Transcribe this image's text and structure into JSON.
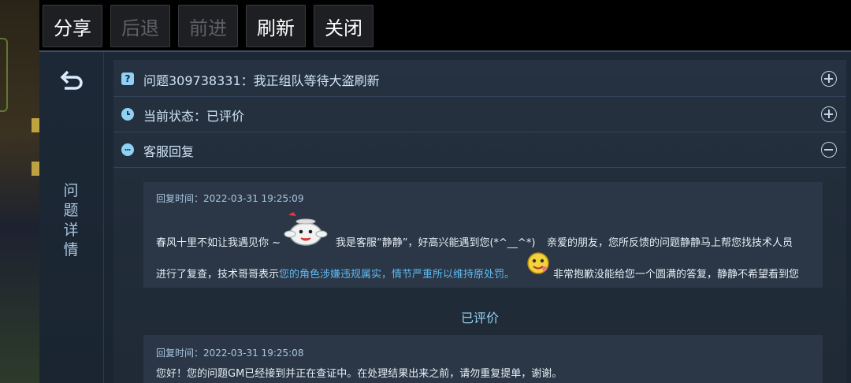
{
  "toolbar": {
    "share": "分享",
    "back": "后退",
    "forward": "前进",
    "refresh": "刷新",
    "close": "关闭"
  },
  "sidebar": {
    "title_chars": [
      "问",
      "题",
      "详",
      "情"
    ]
  },
  "sections": {
    "question": {
      "icon": "question-icon",
      "label": "问题309738331：我正组队等待大盗刷新"
    },
    "status": {
      "icon": "clock-icon",
      "label": "当前状态：已评价"
    },
    "reply": {
      "icon": "chat-icon",
      "label": "客服回复"
    }
  },
  "replies": [
    {
      "time": "回复时间：2022-03-31 19:25:09",
      "part1": "春风十里不如让我遇见你 ~",
      "part2": "我是客服“静静”，好高兴能遇到您(*^__^*)",
      "part3": "亲爱的朋友，您所反馈的问题静静马上帮您找技术人员",
      "line2_a": "进行了复查，技术哥哥表示",
      "line2_highlight": "您的角色涉嫌违规属实，情节严重所以维持原处罚。",
      "line2_b": "非常抱歉没能给您一个圆满的答复，静静不希望看到您"
    },
    {
      "time": "回复时间：2022-03-31 19:25:08",
      "text": "您好！您的问题GM已经接到并正在查证中。在处理结果出来之前，请勿重复提单，谢谢。"
    }
  ],
  "rated_label": "已评价",
  "colors": {
    "accent": "#8fd1f4",
    "highlight": "#5fb8ef",
    "panel": "#1d2836"
  }
}
